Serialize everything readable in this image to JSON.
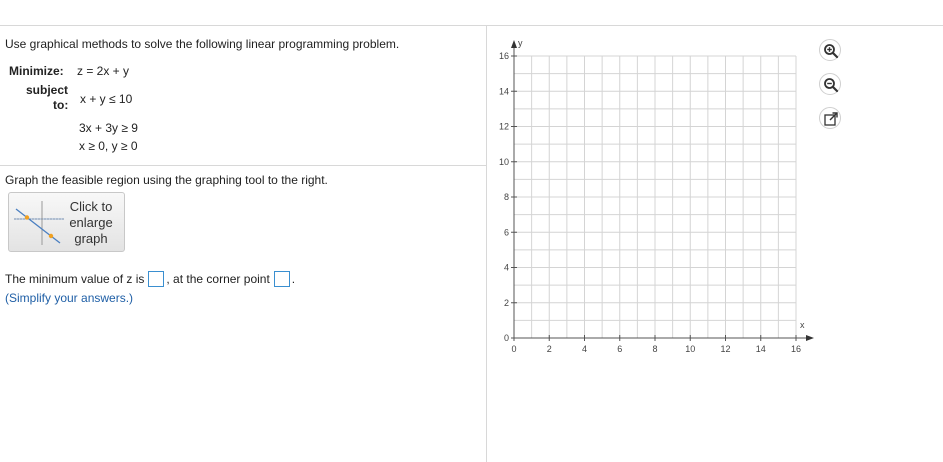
{
  "question": "Use graphical methods to solve the following linear programming problem.",
  "lp": {
    "minimize_label": "Minimize:",
    "objective": "z = 2x + y",
    "subject_label_1": "subject",
    "subject_label_2": "to:",
    "constraints": [
      "x + y ≤ 10",
      "3x + 3y ≥ 9",
      "x ≥ 0, y ≥ 0"
    ]
  },
  "graph_instruction": "Graph the feasible region using the graphing tool to the right.",
  "enlarge_button": {
    "line1": "Click to",
    "line2": "enlarge",
    "line3": "graph"
  },
  "answer": {
    "prefix": "The minimum value of z is",
    "middle": ", at the corner point",
    "suffix": ".",
    "z_value": "",
    "corner_point": "",
    "hint": "(Simplify your answers.)"
  },
  "graph": {
    "x_axis_label": "x",
    "y_axis_label": "y",
    "x_ticks": [
      "0",
      "2",
      "4",
      "6",
      "8",
      "10",
      "12",
      "14",
      "16"
    ],
    "y_ticks": [
      "0",
      "2",
      "4",
      "6",
      "8",
      "10",
      "12",
      "14",
      "16"
    ],
    "x_range": [
      0,
      16
    ],
    "y_range": [
      0,
      16
    ],
    "minor_step": 1,
    "grid": true
  },
  "tools": [
    "zoom-in-icon",
    "zoom-out-icon",
    "open-new-window-icon"
  ]
}
